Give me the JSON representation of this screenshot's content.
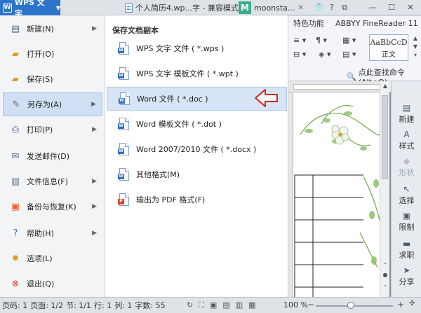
{
  "titlebar": {
    "app_button": "WPS 文字",
    "tabs": [
      {
        "label": "个人简历4.wp...字 - 兼容模式"
      },
      {
        "label": "moonsta..."
      }
    ],
    "m_badge": "M"
  },
  "ribbon": {
    "tabs": [
      "特色功能",
      "ABBYY FineReader 11"
    ],
    "style_preview": "AaBbCcD",
    "style_name": "正文",
    "search_command": "点此查找命令 (Alt+Q)"
  },
  "left_menu": {
    "items": [
      {
        "label": "新建(N)",
        "icon": "new-doc-icon",
        "chevron": true
      },
      {
        "label": "打开(O)",
        "icon": "open-folder-icon",
        "chevron": false
      },
      {
        "label": "保存(S)",
        "icon": "save-icon",
        "chevron": false
      },
      {
        "label": "另存为(A)",
        "icon": "save-as-icon",
        "chevron": true,
        "active": true
      },
      {
        "label": "打印(P)",
        "icon": "print-icon",
        "chevron": true
      },
      {
        "label": "发送邮件(D)",
        "icon": "mail-icon",
        "chevron": false
      },
      {
        "label": "文件信息(F)",
        "icon": "file-info-icon",
        "chevron": true
      },
      {
        "label": "备份与恢复(K)",
        "icon": "backup-icon",
        "chevron": true
      },
      {
        "label": "帮助(H)",
        "icon": "help-icon",
        "chevron": true
      },
      {
        "label": "选项(L)",
        "icon": "options-icon",
        "chevron": false
      },
      {
        "label": "退出(Q)",
        "icon": "exit-icon",
        "chevron": false
      }
    ]
  },
  "save_as_panel": {
    "heading": "保存文档副本",
    "items": [
      {
        "label": "WPS 文字 文件 ( *.wps )",
        "icon": "wps-file-icon"
      },
      {
        "label": "WPS 文字 模板文件 ( *.wpt )",
        "icon": "wps-template-icon"
      },
      {
        "label": "Word 文件 ( *.doc )",
        "icon": "word-doc-icon",
        "active": true
      },
      {
        "label": "Word 模板文件 ( *.dot )",
        "icon": "word-template-icon"
      },
      {
        "label": "Word 2007/2010 文件 ( *.docx )",
        "icon": "word-docx-icon"
      },
      {
        "label": "其他格式(M)",
        "icon": "other-format-icon"
      },
      {
        "label": "输出为 PDF 格式(F)",
        "icon": "pdf-icon"
      }
    ]
  },
  "side_panel": {
    "items": [
      {
        "label": "新建",
        "enabled": true
      },
      {
        "label": "样式",
        "enabled": true
      },
      {
        "label": "形状",
        "enabled": false
      },
      {
        "label": "选择",
        "enabled": true
      },
      {
        "label": "限制",
        "enabled": true
      },
      {
        "label": "求职",
        "enabled": true
      },
      {
        "label": "分享",
        "enabled": true
      }
    ]
  },
  "statusbar": {
    "word_count_label": "字数: 55",
    "segments": [
      "页码: 1",
      "页面: 1/2",
      "节: 1/1",
      "行: 1",
      "列: 1"
    ],
    "zoom": "100 %",
    "zoom_fraction": 0.45
  }
}
